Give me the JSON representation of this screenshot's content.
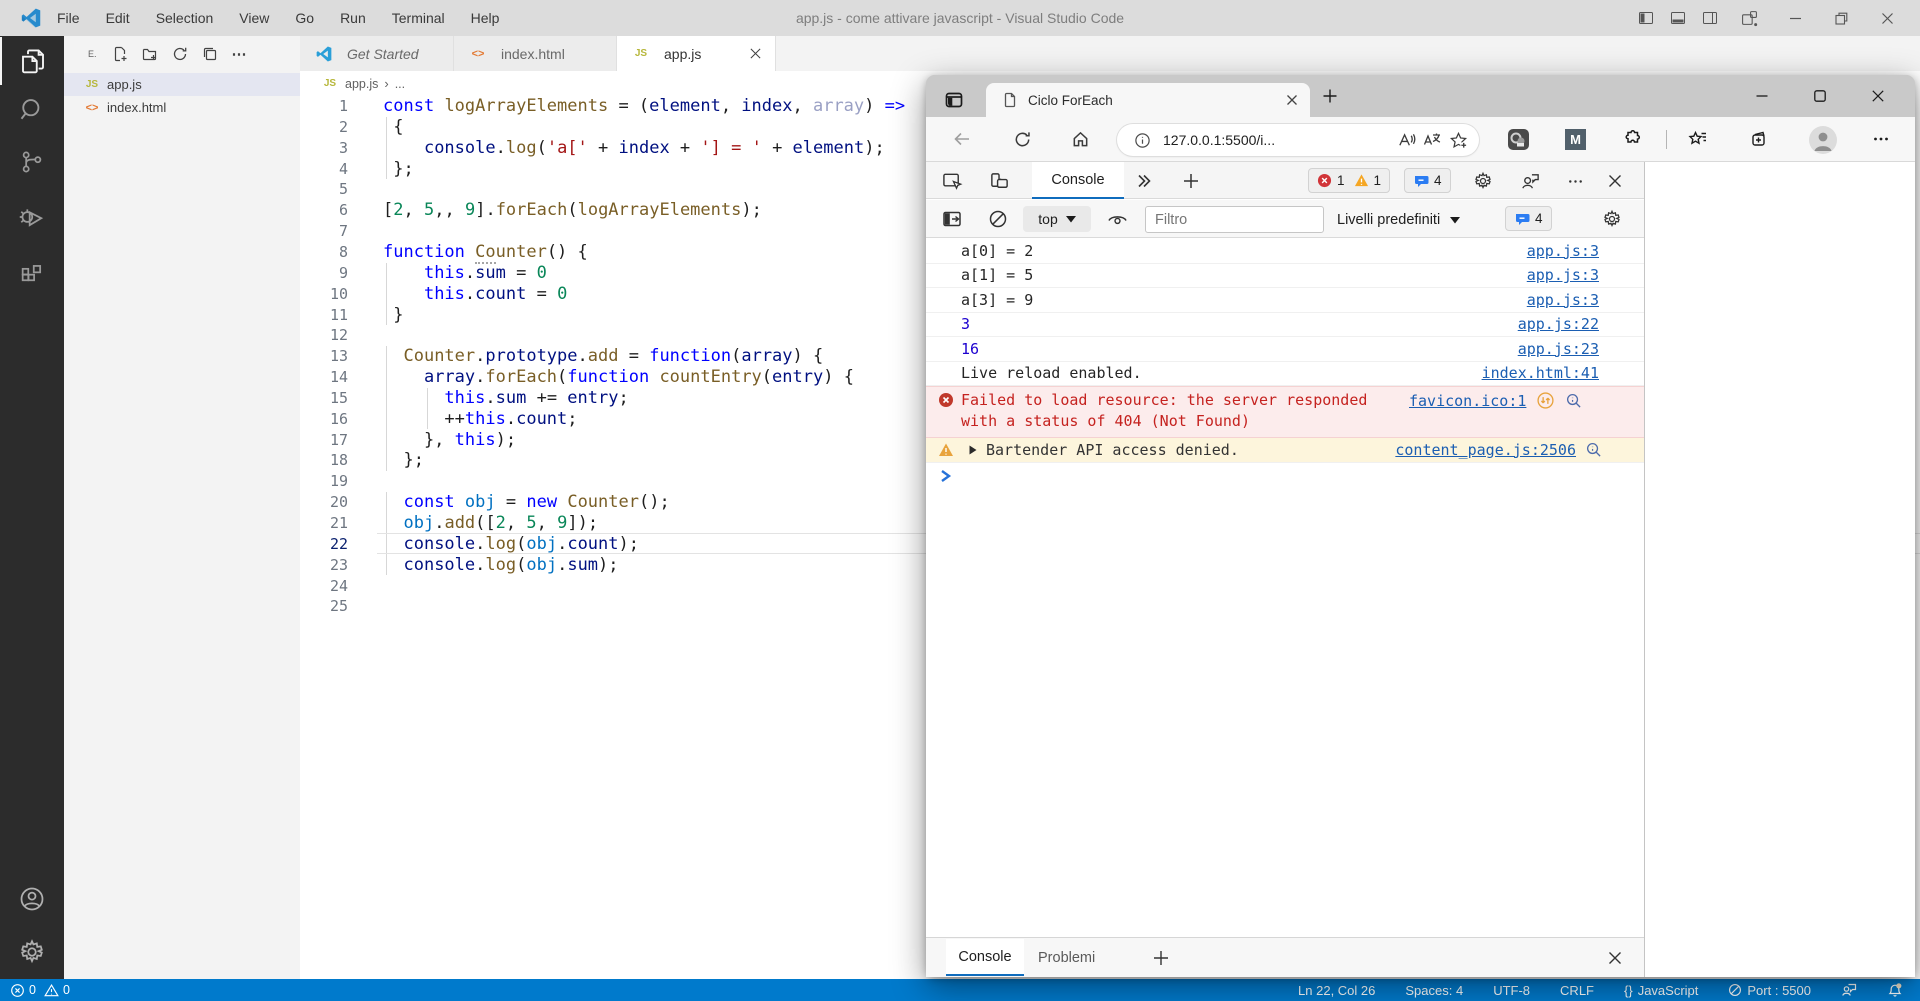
{
  "vscode": {
    "titlebar": {
      "menus": [
        "File",
        "Edit",
        "Selection",
        "View",
        "Go",
        "Run",
        "Terminal",
        "Help"
      ],
      "title": "app.js - come attivare javascript - Visual Studio Code"
    },
    "activitybar": {
      "items": [
        "explorer",
        "search",
        "source-control",
        "run-and-debug",
        "extensions"
      ],
      "bottom": [
        "accounts",
        "manage"
      ]
    },
    "sidebar": {
      "header": "E.",
      "actions": [
        "new-file",
        "new-folder",
        "refresh",
        "collapse-all",
        "more"
      ],
      "files": [
        {
          "name": "app.js",
          "icon": "js",
          "selected": true
        },
        {
          "name": "index.html",
          "icon": "html",
          "selected": false
        }
      ]
    },
    "tabs": [
      {
        "label": "Get Started",
        "icon": "vscode-logo",
        "italic": true,
        "active": false,
        "close": false
      },
      {
        "label": "index.html",
        "icon": "html",
        "italic": false,
        "active": false,
        "close": false
      },
      {
        "label": "app.js",
        "icon": "js",
        "italic": false,
        "active": true,
        "close": true
      }
    ],
    "breadcrumb": {
      "file": "app.js",
      "more": "..."
    },
    "statusbar": {
      "errors": "0",
      "warnings": "0",
      "cursor": "Ln 22, Col 26",
      "indent": "Spaces: 4",
      "encoding": "UTF-8",
      "eol": "CRLF",
      "language": "JavaScript",
      "language_prefix": "{}",
      "port": "Port : 5500"
    },
    "editor": {
      "current_line": 22,
      "lines": [
        {
          "n": "1",
          "t": [
            [
              "kw",
              "const"
            ],
            [
              "d",
              " "
            ],
            [
              "fn",
              "logArrayElements"
            ],
            [
              "d",
              " = ("
            ],
            [
              "v",
              "element"
            ],
            [
              "d",
              ", "
            ],
            [
              "v",
              "index"
            ],
            [
              "d",
              ", "
            ],
            [
              "dim",
              "array"
            ],
            [
              "d",
              ") "
            ],
            [
              "kw",
              "=>"
            ]
          ]
        },
        {
          "n": "2",
          "t": [
            [
              "d",
              " {"
            ]
          ]
        },
        {
          "n": "3",
          "t": [
            [
              "d",
              "    "
            ],
            [
              "v",
              "console"
            ],
            [
              "d",
              "."
            ],
            [
              "fn",
              "log"
            ],
            [
              "d",
              "("
            ],
            [
              "str",
              "'a['"
            ],
            [
              "d",
              " + "
            ],
            [
              "v",
              "index"
            ],
            [
              "d",
              " + "
            ],
            [
              "str",
              "'] = '"
            ],
            [
              "d",
              " + "
            ],
            [
              "v",
              "element"
            ],
            [
              "d",
              ");"
            ]
          ]
        },
        {
          "n": "4",
          "t": [
            [
              "d",
              " };"
            ]
          ]
        },
        {
          "n": "5",
          "t": []
        },
        {
          "n": "6",
          "t": [
            [
              "d",
              "["
            ],
            [
              "num",
              "2"
            ],
            [
              "d",
              ", "
            ],
            [
              "num",
              "5"
            ],
            [
              "d",
              ",, "
            ],
            [
              "num",
              "9"
            ],
            [
              "d",
              "]."
            ],
            [
              "fn",
              "forEach"
            ],
            [
              "d",
              "("
            ],
            [
              "fn",
              "logArrayElements"
            ],
            [
              "d",
              ");"
            ]
          ]
        },
        {
          "n": "7",
          "t": []
        },
        {
          "n": "8",
          "t": [
            [
              "kw",
              "function"
            ],
            [
              "d",
              " "
            ],
            [
              "fnh",
              "Co"
            ],
            [
              "fn",
              "unter"
            ],
            [
              "d",
              "() {"
            ]
          ]
        },
        {
          "n": "9",
          "t": [
            [
              "d",
              "    "
            ],
            [
              "kw",
              "this"
            ],
            [
              "d",
              "."
            ],
            [
              "v",
              "sum"
            ],
            [
              "d",
              " = "
            ],
            [
              "num",
              "0"
            ]
          ]
        },
        {
          "n": "10",
          "t": [
            [
              "d",
              "    "
            ],
            [
              "kw",
              "this"
            ],
            [
              "d",
              "."
            ],
            [
              "v",
              "count"
            ],
            [
              "d",
              " = "
            ],
            [
              "num",
              "0"
            ]
          ]
        },
        {
          "n": "11",
          "t": [
            [
              "d",
              " }"
            ]
          ]
        },
        {
          "n": "12",
          "t": []
        },
        {
          "n": "13",
          "t": [
            [
              "d",
              "  "
            ],
            [
              "fn",
              "Counter"
            ],
            [
              "d",
              "."
            ],
            [
              "v",
              "prototype"
            ],
            [
              "d",
              "."
            ],
            [
              "fn",
              "add"
            ],
            [
              "d",
              " = "
            ],
            [
              "kw",
              "function"
            ],
            [
              "d",
              "("
            ],
            [
              "v",
              "array"
            ],
            [
              "d",
              ") {"
            ]
          ]
        },
        {
          "n": "14",
          "t": [
            [
              "d",
              "    "
            ],
            [
              "v",
              "array"
            ],
            [
              "d",
              "."
            ],
            [
              "fn",
              "forEach"
            ],
            [
              "d",
              "("
            ],
            [
              "kw",
              "function"
            ],
            [
              "d",
              " "
            ],
            [
              "fn",
              "countEntry"
            ],
            [
              "d",
              "("
            ],
            [
              "v",
              "entry"
            ],
            [
              "d",
              ") {"
            ]
          ]
        },
        {
          "n": "15",
          "t": [
            [
              "d",
              "      "
            ],
            [
              "kw",
              "this"
            ],
            [
              "d",
              "."
            ],
            [
              "v",
              "sum"
            ],
            [
              "d",
              " += "
            ],
            [
              "v",
              "entry"
            ],
            [
              "d",
              ";"
            ]
          ]
        },
        {
          "n": "16",
          "t": [
            [
              "d",
              "      ++"
            ],
            [
              "kw",
              "this"
            ],
            [
              "d",
              "."
            ],
            [
              "v",
              "count"
            ],
            [
              "d",
              ";"
            ]
          ]
        },
        {
          "n": "17",
          "t": [
            [
              "d",
              "    }, "
            ],
            [
              "kw",
              "this"
            ],
            [
              "d",
              ");"
            ]
          ]
        },
        {
          "n": "18",
          "t": [
            [
              "d",
              "  };"
            ]
          ]
        },
        {
          "n": "19",
          "t": []
        },
        {
          "n": "20",
          "t": [
            [
              "d",
              "  "
            ],
            [
              "kw",
              "const"
            ],
            [
              "d",
              " "
            ],
            [
              "cv",
              "obj"
            ],
            [
              "d",
              " = "
            ],
            [
              "kw",
              "new"
            ],
            [
              "d",
              " "
            ],
            [
              "fn",
              "Counter"
            ],
            [
              "d",
              "();"
            ]
          ]
        },
        {
          "n": "21",
          "t": [
            [
              "d",
              "  "
            ],
            [
              "cv",
              "obj"
            ],
            [
              "d",
              "."
            ],
            [
              "fn",
              "add"
            ],
            [
              "d",
              "(["
            ],
            [
              "num",
              "2"
            ],
            [
              "d",
              ", "
            ],
            [
              "num",
              "5"
            ],
            [
              "d",
              ", "
            ],
            [
              "num",
              "9"
            ],
            [
              "d",
              "]);"
            ]
          ]
        },
        {
          "n": "22",
          "t": [
            [
              "d",
              "  "
            ],
            [
              "v",
              "console"
            ],
            [
              "d",
              "."
            ],
            [
              "fn",
              "log"
            ],
            [
              "d",
              "("
            ],
            [
              "cv",
              "obj"
            ],
            [
              "d",
              "."
            ],
            [
              "v",
              "count"
            ],
            [
              "d",
              ");"
            ]
          ]
        },
        {
          "n": "23",
          "t": [
            [
              "d",
              "  "
            ],
            [
              "v",
              "console"
            ],
            [
              "d",
              "."
            ],
            [
              "fn",
              "log"
            ],
            [
              "d",
              "("
            ],
            [
              "cv",
              "obj"
            ],
            [
              "d",
              "."
            ],
            [
              "v",
              "sum"
            ],
            [
              "d",
              ");"
            ]
          ]
        },
        {
          "n": "24",
          "t": []
        },
        {
          "n": "25",
          "t": []
        }
      ]
    }
  },
  "browser": {
    "tab": {
      "title": "Ciclo ForEach"
    },
    "address": {
      "url": "127.0.0.1:5500/i..."
    },
    "extensions": {
      "ext2_label": "M"
    },
    "devtools": {
      "tabbar": {
        "active_tab": "Console",
        "errors": "1",
        "warnings": "1",
        "messages": "4"
      },
      "toolbar": {
        "context": "top",
        "filter_placeholder": "Filtro",
        "levels": "Livelli predefiniti",
        "messages": "4"
      },
      "rows": [
        {
          "type": "log",
          "text": "a[0] = 2",
          "link": "app.js:3"
        },
        {
          "type": "log",
          "text": "a[1] = 5",
          "link": "app.js:3"
        },
        {
          "type": "log",
          "text": "a[3] = 9",
          "link": "app.js:3"
        },
        {
          "type": "num",
          "text": "3",
          "link": "app.js:22"
        },
        {
          "type": "num",
          "text": "16",
          "link": "app.js:23"
        },
        {
          "type": "log",
          "text": "Live reload enabled.",
          "link": "index.html:41"
        },
        {
          "type": "error",
          "text": "Failed to load resource: the server responded with a status of 404 (Not Found)",
          "link": "favicon.ico:1"
        },
        {
          "type": "warn",
          "text": "Bartender API access denied.",
          "link": "content_page.js:2506"
        }
      ],
      "drawer": {
        "tabs": [
          "Console",
          "Problemi"
        ]
      }
    }
  },
  "colors": {
    "statusbar": "#007acc",
    "activitybar": "#2c2c2c",
    "titlebar": "#dcdcdc",
    "devtools_accent": "#0f6cbd",
    "error_bg": "#fcecec",
    "warn_bg": "#fdf5dc",
    "error_text": "#c5221f",
    "link": "#1b5eb2",
    "selection": "#e4e6f1"
  }
}
